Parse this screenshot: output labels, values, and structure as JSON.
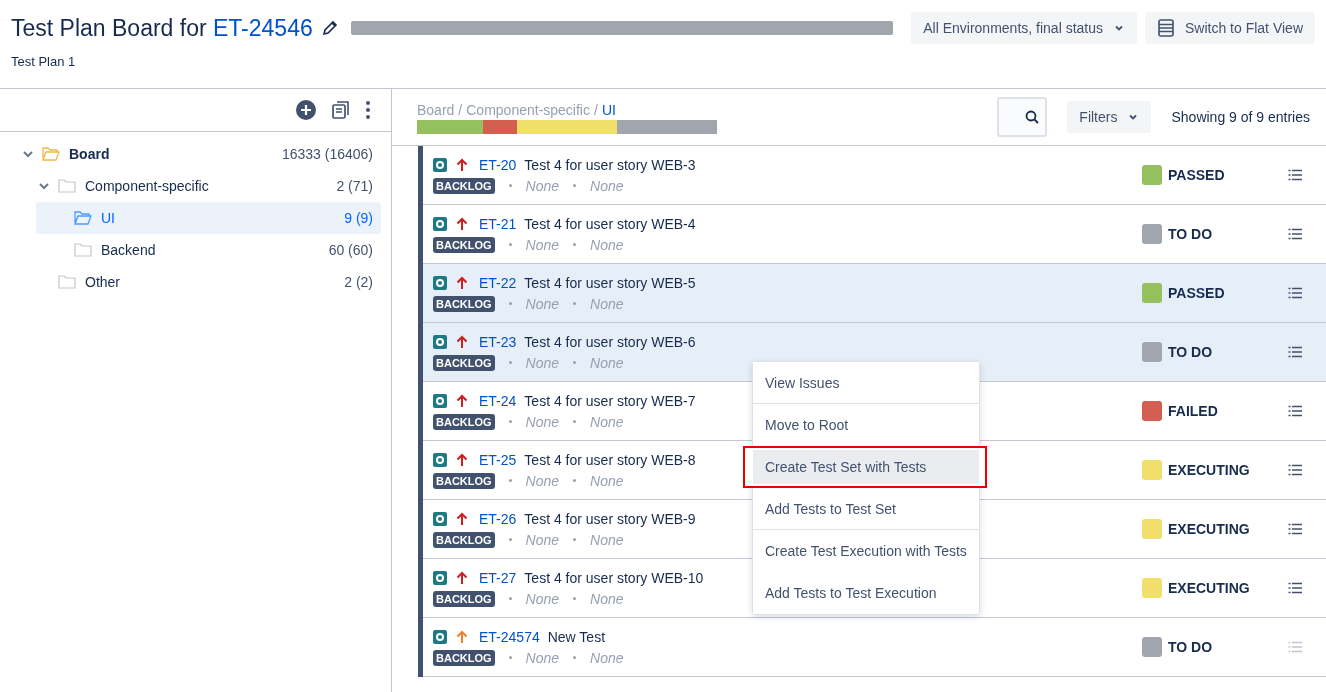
{
  "header": {
    "title": "Test Plan Board for",
    "issue_key": "ET-24546",
    "subtitle": "Test Plan 1",
    "title_bar": {
      "level": 1
    },
    "environment_select": "All Environments, final status",
    "flat_view_button": "Switch to Flat View"
  },
  "tree": {
    "items": [
      {
        "label": "Board",
        "count": "16333 (16406)",
        "expanded": true,
        "selected": false,
        "children": [
          {
            "label": "Component-specific",
            "count": "2 (71)",
            "expanded": true,
            "selected": false,
            "children": [
              {
                "label": "UI",
                "count": "9 (9)",
                "selected": true
              },
              {
                "label": "Backend",
                "count": "60 (60)",
                "selected": false
              }
            ]
          },
          {
            "label": "Other",
            "count": "2 (2)",
            "selected": false
          }
        ]
      }
    ]
  },
  "list": {
    "breadcrumb_separator": "/",
    "breadcrumb": [
      {
        "label": "Board",
        "current": false
      },
      {
        "label": "Component-specific",
        "current": false
      },
      {
        "label": "UI",
        "current": true
      }
    ],
    "filters_button": "Filters",
    "entries": "Showing 9 of 9 entries",
    "rows": [
      {
        "key": "ET-20",
        "summary": "Test 4 for user story WEB-3",
        "status_tag": "BACKLOG",
        "field_1": "None",
        "field_2": "None",
        "kind": "high",
        "status": "PASSED",
        "color": "#94c15e",
        "selected": false,
        "dimmed": false
      },
      {
        "key": "ET-21",
        "summary": "Test 4 for user story WEB-4",
        "status_tag": "BACKLOG",
        "field_1": "None",
        "field_2": "None",
        "kind": "high",
        "status": "TO DO",
        "color": "#a1a5ae",
        "selected": false,
        "dimmed": false
      },
      {
        "key": "ET-22",
        "summary": "Test 4 for user story WEB-5",
        "status_tag": "BACKLOG",
        "field_1": "None",
        "field_2": "None",
        "kind": "high",
        "status": "PASSED",
        "color": "#94c15e",
        "selected": true,
        "dimmed": false
      },
      {
        "key": "ET-23",
        "summary": "Test 4 for user story WEB-6",
        "status_tag": "BACKLOG",
        "field_1": "None",
        "field_2": "None",
        "kind": "high",
        "status": "TO DO",
        "color": "#a1a5ae",
        "selected": true,
        "dimmed": false
      },
      {
        "key": "ET-24",
        "summary": "Test 4 for user story WEB-7",
        "status_tag": "BACKLOG",
        "field_1": "None",
        "field_2": "None",
        "kind": "high",
        "status": "FAILED",
        "color": "#d45e4f",
        "selected": false,
        "dimmed": false
      },
      {
        "key": "ET-25",
        "summary": "Test 4 for user story WEB-8",
        "status_tag": "BACKLOG",
        "field_1": "None",
        "field_2": "None",
        "kind": "high",
        "status": "EXECUTING",
        "color": "#f0df6a",
        "selected": false,
        "dimmed": false
      },
      {
        "key": "ET-26",
        "summary": "Test 4 for user story WEB-9",
        "status_tag": "BACKLOG",
        "field_1": "None",
        "field_2": "None",
        "kind": "high",
        "status": "EXECUTING",
        "color": "#f0df6a",
        "selected": false,
        "dimmed": false
      },
      {
        "key": "ET-27",
        "summary": "Test 4 for user story WEB-10",
        "status_tag": "BACKLOG",
        "field_1": "None",
        "field_2": "None",
        "kind": "high",
        "status": "EXECUTING",
        "color": "#f0df6a",
        "selected": false,
        "dimmed": false
      },
      {
        "key": "ET-24574",
        "summary": "New Test",
        "status_tag": "BACKLOG",
        "field_1": "None",
        "field_2": "None",
        "kind": "medium",
        "status": "TO DO",
        "color": "#a1a5ae",
        "selected": false,
        "dimmed": true
      }
    ]
  },
  "context_menu": {
    "items": [
      {
        "label": "View Issues",
        "highlighted": false,
        "divider_after": true
      },
      {
        "label": "Move to Root",
        "highlighted": false,
        "divider_after": false
      },
      {
        "label": "Create Test Set with Tests",
        "highlighted": true,
        "divider_after": false
      },
      {
        "label": "Add Tests to Test Set",
        "highlighted": false,
        "divider_after": true
      },
      {
        "label": "Create Test Execution with Tests",
        "highlighted": false,
        "divider_after": false
      },
      {
        "label": "Add Tests to Test Execution",
        "highlighted": false,
        "divider_after": false
      }
    ]
  }
}
